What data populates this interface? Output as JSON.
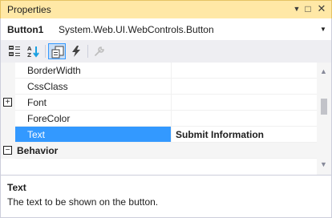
{
  "window": {
    "title": "Properties",
    "pin_glyph": "▼",
    "maximize_glyph": "□",
    "close_glyph": "✕"
  },
  "object_selector": {
    "name": "Button1",
    "type": "System.Web.UI.WebControls.Button",
    "dropdown_glyph": "▼"
  },
  "toolbar": {
    "buttons": [
      {
        "icon": "categorized-icon",
        "active": false
      },
      {
        "icon": "alphabetical-icon",
        "active": false
      },
      {
        "icon": "properties-icon",
        "active": true
      },
      {
        "icon": "events-icon",
        "active": false
      },
      {
        "icon": "property-pages-icon",
        "active": false
      }
    ]
  },
  "grid": {
    "rows": [
      {
        "name": "BorderWidth",
        "value": ""
      },
      {
        "name": "CssClass",
        "value": ""
      },
      {
        "name": "Font",
        "value": "",
        "expander": "⊞"
      },
      {
        "name": "ForeColor",
        "value": ""
      },
      {
        "name": "Text",
        "value": "Submit Information",
        "selected": true
      },
      {
        "name": "Behavior",
        "value": "",
        "category": true,
        "expander": "⊟"
      }
    ],
    "expander_collapsed": "+",
    "expander_expanded": "−",
    "scroll_up_glyph": "▲",
    "scroll_down_glyph": "▼"
  },
  "description": {
    "title": "Text",
    "text": "The text to be shown on the button."
  },
  "colors": {
    "titlebar": "#ffe8a6",
    "selection": "#3399ff",
    "toolbar": "#eeeef2"
  }
}
